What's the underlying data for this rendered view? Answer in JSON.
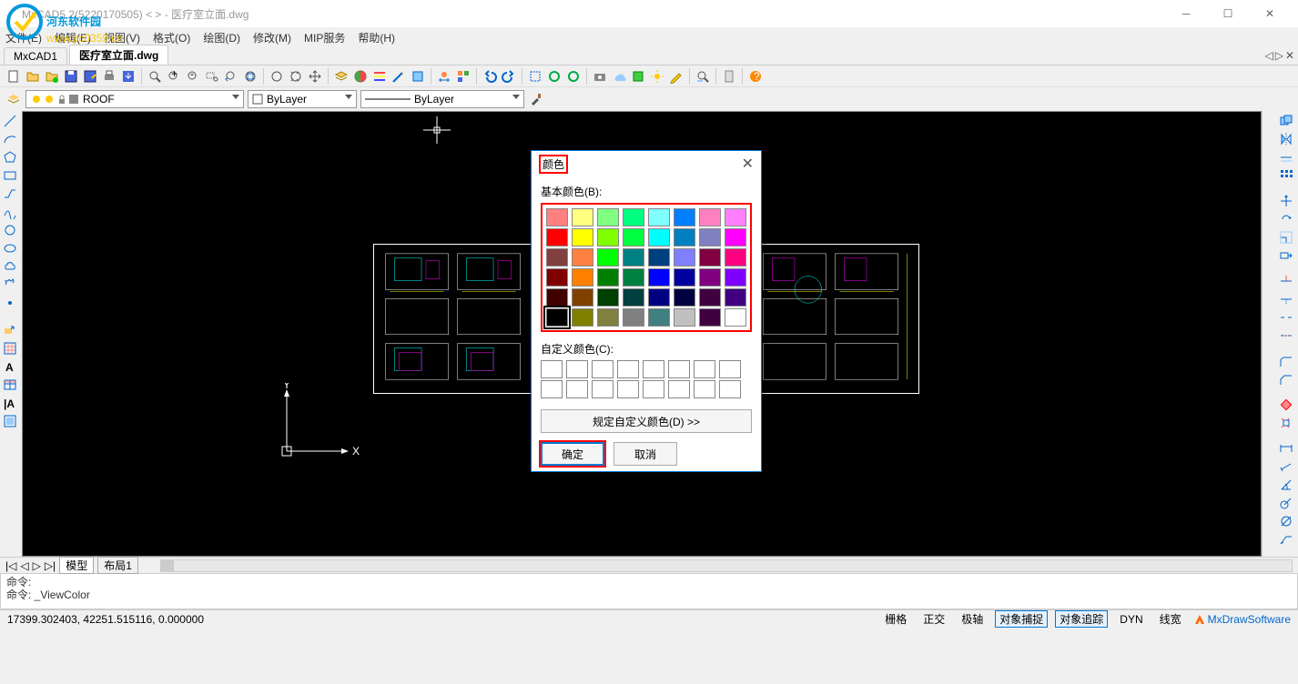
{
  "window": {
    "title": "MxCAD5.2(5220170505) < > - 医疗室立面.dwg",
    "logo_text1": "河东软件园",
    "logo_text2": "www.pc0359.cn"
  },
  "menubar": {
    "file": "文件(E)",
    "edit": "编辑(E)",
    "view": "视图(V)",
    "format": "格式(O)",
    "draw": "绘图(D)",
    "modify": "修改(M)",
    "mxdraw": "MIP服务",
    "help": "帮助(H)"
  },
  "tabs": {
    "t1": "MxCAD1",
    "t2": "医疗室立面.dwg"
  },
  "props": {
    "layer": "ROOF",
    "color": "ByLayer",
    "linetype": "ByLayer"
  },
  "canvas": {
    "ucs_x": "X",
    "ucs_y": "Y"
  },
  "dialog": {
    "title": "颜色",
    "basic_label": "基本颜色(B):",
    "custom_label": "自定义颜色(C):",
    "define_btn": "规定自定义颜色(D) >>",
    "ok": "确定",
    "cancel": "取消",
    "colors": [
      "#ff8080",
      "#ffff80",
      "#80ff80",
      "#00ff80",
      "#80ffff",
      "#0080ff",
      "#ff80c0",
      "#ff80ff",
      "#ff0000",
      "#ffff00",
      "#80ff00",
      "#00ff40",
      "#00ffff",
      "#0080c0",
      "#8080c0",
      "#ff00ff",
      "#804040",
      "#ff8040",
      "#00ff00",
      "#008080",
      "#004080",
      "#8080ff",
      "#800040",
      "#ff0080",
      "#800000",
      "#ff8000",
      "#008000",
      "#008040",
      "#0000ff",
      "#0000a0",
      "#800080",
      "#8000ff",
      "#400000",
      "#804000",
      "#004000",
      "#004040",
      "#000080",
      "#000040",
      "#400040",
      "#400080",
      "#000000",
      "#808000",
      "#808040",
      "#808080",
      "#408080",
      "#c0c0c0",
      "#400040",
      "#ffffff"
    ]
  },
  "bottomtabs": {
    "model": "模型",
    "layout": "布局1"
  },
  "cmd": {
    "l1": "命令:",
    "l2": "命令: _ViewColor"
  },
  "status": {
    "coords": "17399.302403, 42251.515116, 0.000000",
    "grid": "栅格",
    "ortho": "正交",
    "polar": "极轴",
    "osnap": "对象捕捉",
    "otrack": "对象追踪",
    "dyn": "DYN",
    "lwt": "线宽",
    "brand": "MxDrawSoftware"
  }
}
